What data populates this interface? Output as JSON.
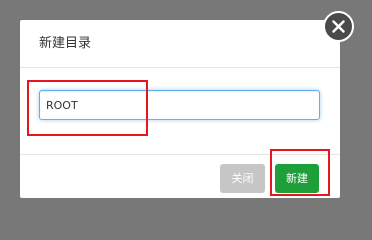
{
  "dialog": {
    "title": "新建目录",
    "name_input": {
      "value": "ROOT",
      "placeholder": ""
    },
    "buttons": {
      "close_label": "关闭",
      "create_label": "新建"
    }
  },
  "icons": {
    "dialog_close": "close-icon"
  },
  "colors": {
    "overlay": "#787878",
    "close_button": "#c6c6c6",
    "create_button": "#1f9f3a",
    "highlight": "#e5161f",
    "input_focus_border": "#66afe9"
  }
}
